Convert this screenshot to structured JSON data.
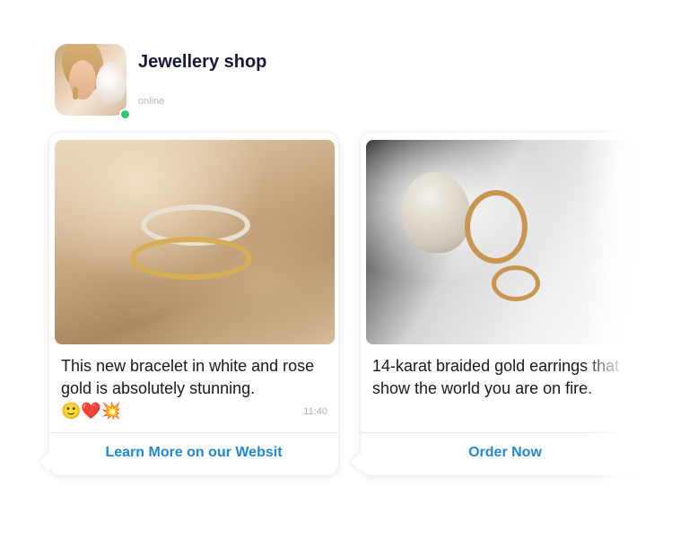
{
  "header": {
    "shop_name": "Jewellery shop",
    "status": "online",
    "status_color": "#2ecc71"
  },
  "cards": [
    {
      "text": "This new bracelet in white and rose gold is absolutely stunning.",
      "emojis": "🙂❤️💥",
      "time": "11:40",
      "action_label": "Learn More on our Websit"
    },
    {
      "text": "14-karat braided gold earrings that show the world you are on fire.",
      "action_label": "Order Now"
    }
  ],
  "colors": {
    "title": "#151a3d",
    "action": "#2188d9"
  }
}
